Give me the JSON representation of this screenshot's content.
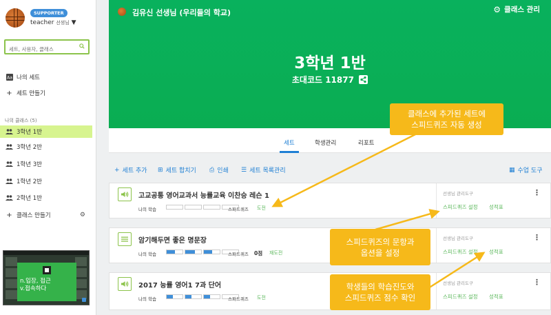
{
  "colors": {
    "header_green": "#09b15d",
    "accent_blue": "#1e7fd4",
    "active_lime": "#d7f48f",
    "callout_orange": "#f6b91a",
    "ok_green": "#5cb85c"
  },
  "sidebar": {
    "badge": "SUPPORTER",
    "username": "teacher",
    "role": "선생님",
    "search_placeholder": "세트, 사용자, 클래스",
    "my_sets": "나의 세트",
    "make_set": "세트 만들기",
    "classes_heading": "나의 클래스 (5)",
    "classes": [
      {
        "label": "3학년 1반",
        "active": true
      },
      {
        "label": "3학년 2반",
        "active": false
      },
      {
        "label": "1학년 3반",
        "active": false
      },
      {
        "label": "1학년 2반",
        "active": false
      },
      {
        "label": "2학년 1반",
        "active": false
      }
    ],
    "make_class": "클래스 만들기",
    "thumbnail_text_1": "n.입장, 접근",
    "thumbnail_text_2": "v.접속하다"
  },
  "header": {
    "teacher": "김유신 선생님  (우리들의 학교)",
    "manage": "클래스 관리",
    "class_name": "3학년 1반",
    "invite_code": "초대코드 11877"
  },
  "tabs": [
    {
      "label": "세트",
      "active": true
    },
    {
      "label": "학생관리",
      "active": false
    },
    {
      "label": "리포트",
      "active": false
    }
  ],
  "toolbar": {
    "add_set": "세트 추가",
    "merge_set": "세트 합치기",
    "print": "인쇄",
    "set_list": "세트 목록관리",
    "class_tools": "수업 도구"
  },
  "cards": [
    {
      "title": "고교공통 영어교과서 능률교육 이찬승 레슨 1",
      "icon": "speaker-icon",
      "my_learning": "나의 학습",
      "progress": [
        0,
        0,
        0,
        0
      ],
      "speed_quiz": "스피드퀴즈",
      "score": "",
      "status": "도전",
      "tool_label": "선생님 관리도구",
      "tool_quiz": "스피드퀴즈 설정",
      "tool_grades": "성적표"
    },
    {
      "title": "암기해두면 좋은 명문장",
      "icon": "list-icon",
      "my_learning": "나의 학습",
      "progress": [
        0.5,
        0.6,
        0.5,
        0
      ],
      "speed_quiz": "스피드퀴즈",
      "score": "0점",
      "status": "재도전",
      "tool_label": "선생님 관리도구",
      "tool_quiz": "스피드퀴즈 설정",
      "tool_grades": "성적표"
    },
    {
      "title": "2017 능률 영어1 7과 단어",
      "icon": "speaker-icon",
      "my_learning": "나의 학습",
      "progress": [
        0.4,
        0.4,
        0.4,
        0
      ],
      "speed_quiz": "스피드퀴즈",
      "score": "",
      "status": "도전",
      "tool_label": "선생님 관리도구",
      "tool_quiz": "스피드퀴즈 설정",
      "tool_grades": "성적표"
    }
  ],
  "callouts": [
    {
      "line1": "클래스에 추가된 세트에",
      "line2": "스피드퀴즈 자동 생성"
    },
    {
      "line1": "스피드퀴즈의 문항과",
      "line2": "옵션을 설정"
    },
    {
      "line1": "학생들의 학습진도와",
      "line2": "스피드퀴즈 점수 확인"
    }
  ]
}
